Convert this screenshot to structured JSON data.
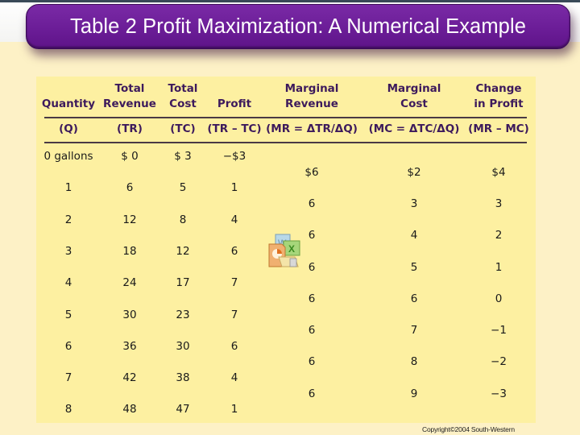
{
  "slide": {
    "title": "Table 2 Profit Maximization: A Numerical Example",
    "copyright": "Copyright©2004  South-Western"
  },
  "table": {
    "headers": [
      {
        "line1": "",
        "line2": "Quantity",
        "symbol": "(Q)"
      },
      {
        "line1": "Total",
        "line2": "Revenue",
        "symbol": "(TR)"
      },
      {
        "line1": "Total",
        "line2": "Cost",
        "symbol": "(TC)"
      },
      {
        "line1": "",
        "line2": "Profit",
        "symbol": "(TR – TC)"
      },
      {
        "line1": "Marginal",
        "line2": "Revenue",
        "symbol": "(MR = ΔTR/ΔQ)"
      },
      {
        "line1": "Marginal",
        "line2": "Cost",
        "symbol": "(MC = ΔTC/ΔQ)"
      },
      {
        "line1": "Change",
        "line2": "in Profit",
        "symbol": "(MR – MC)"
      }
    ],
    "rows": [
      {
        "quantity": "0 gallons",
        "tr": "$ 0",
        "tc": "$ 3",
        "profit": "−$3"
      },
      {
        "quantity": "1",
        "tr": "6",
        "tc": "5",
        "profit": "1"
      },
      {
        "quantity": "2",
        "tr": "12",
        "tc": "8",
        "profit": "4"
      },
      {
        "quantity": "3",
        "tr": "18",
        "tc": "12",
        "profit": "6"
      },
      {
        "quantity": "4",
        "tr": "24",
        "tc": "17",
        "profit": "7"
      },
      {
        "quantity": "5",
        "tr": "30",
        "tc": "23",
        "profit": "7"
      },
      {
        "quantity": "6",
        "tr": "36",
        "tc": "30",
        "profit": "6"
      },
      {
        "quantity": "7",
        "tr": "42",
        "tc": "38",
        "profit": "4"
      },
      {
        "quantity": "8",
        "tr": "48",
        "tc": "47",
        "profit": "1"
      }
    ],
    "marginal_rows": [
      {
        "mr": "$6",
        "mc": "$2",
        "change": "$4"
      },
      {
        "mr": "6",
        "mc": "3",
        "change": "3"
      },
      {
        "mr": "6",
        "mc": "4",
        "change": "2"
      },
      {
        "mr": "6",
        "mc": "5",
        "change": "1"
      },
      {
        "mr": "6",
        "mc": "6",
        "change": "0"
      },
      {
        "mr": "6",
        "mc": "7",
        "change": "−1"
      },
      {
        "mr": "6",
        "mc": "8",
        "change": "−2"
      },
      {
        "mr": "6",
        "mc": "9",
        "change": "−3"
      }
    ]
  },
  "icons": {
    "office": "office-documents-icon"
  }
}
